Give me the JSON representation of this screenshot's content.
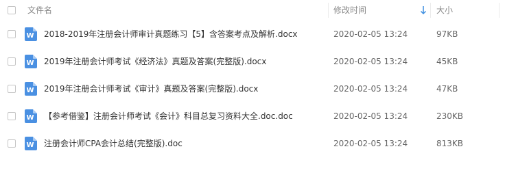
{
  "header": {
    "name_label": "文件名",
    "time_label": "修改时间",
    "size_label": "大小",
    "sort_icon": "arrow-down-icon"
  },
  "file_icon": {
    "name": "word-doc-icon",
    "letter": "W",
    "color": "#4a90e2"
  },
  "files": [
    {
      "name": "2018-2019年注册会计师审计真题练习【5】含答案考点及解析.docx",
      "modified": "2020-02-05 13:24",
      "size": "97KB"
    },
    {
      "name": "2019年注册会计师考试《经济法》真题及答案(完整版).docx",
      "modified": "2020-02-05 13:24",
      "size": "45KB"
    },
    {
      "name": "2019年注册会计师考试《审计》真题及答案(完整版).docx",
      "modified": "2020-02-05 13:24",
      "size": "47KB"
    },
    {
      "name": "【参考借鉴】注册会计师考试《会计》科目总复习资料大全.doc.doc",
      "modified": "2020-02-05 13:24",
      "size": "230KB"
    },
    {
      "name": "注册会计师CPA会计总结(完整版).doc",
      "modified": "2020-02-05 13:24",
      "size": "813KB"
    }
  ]
}
